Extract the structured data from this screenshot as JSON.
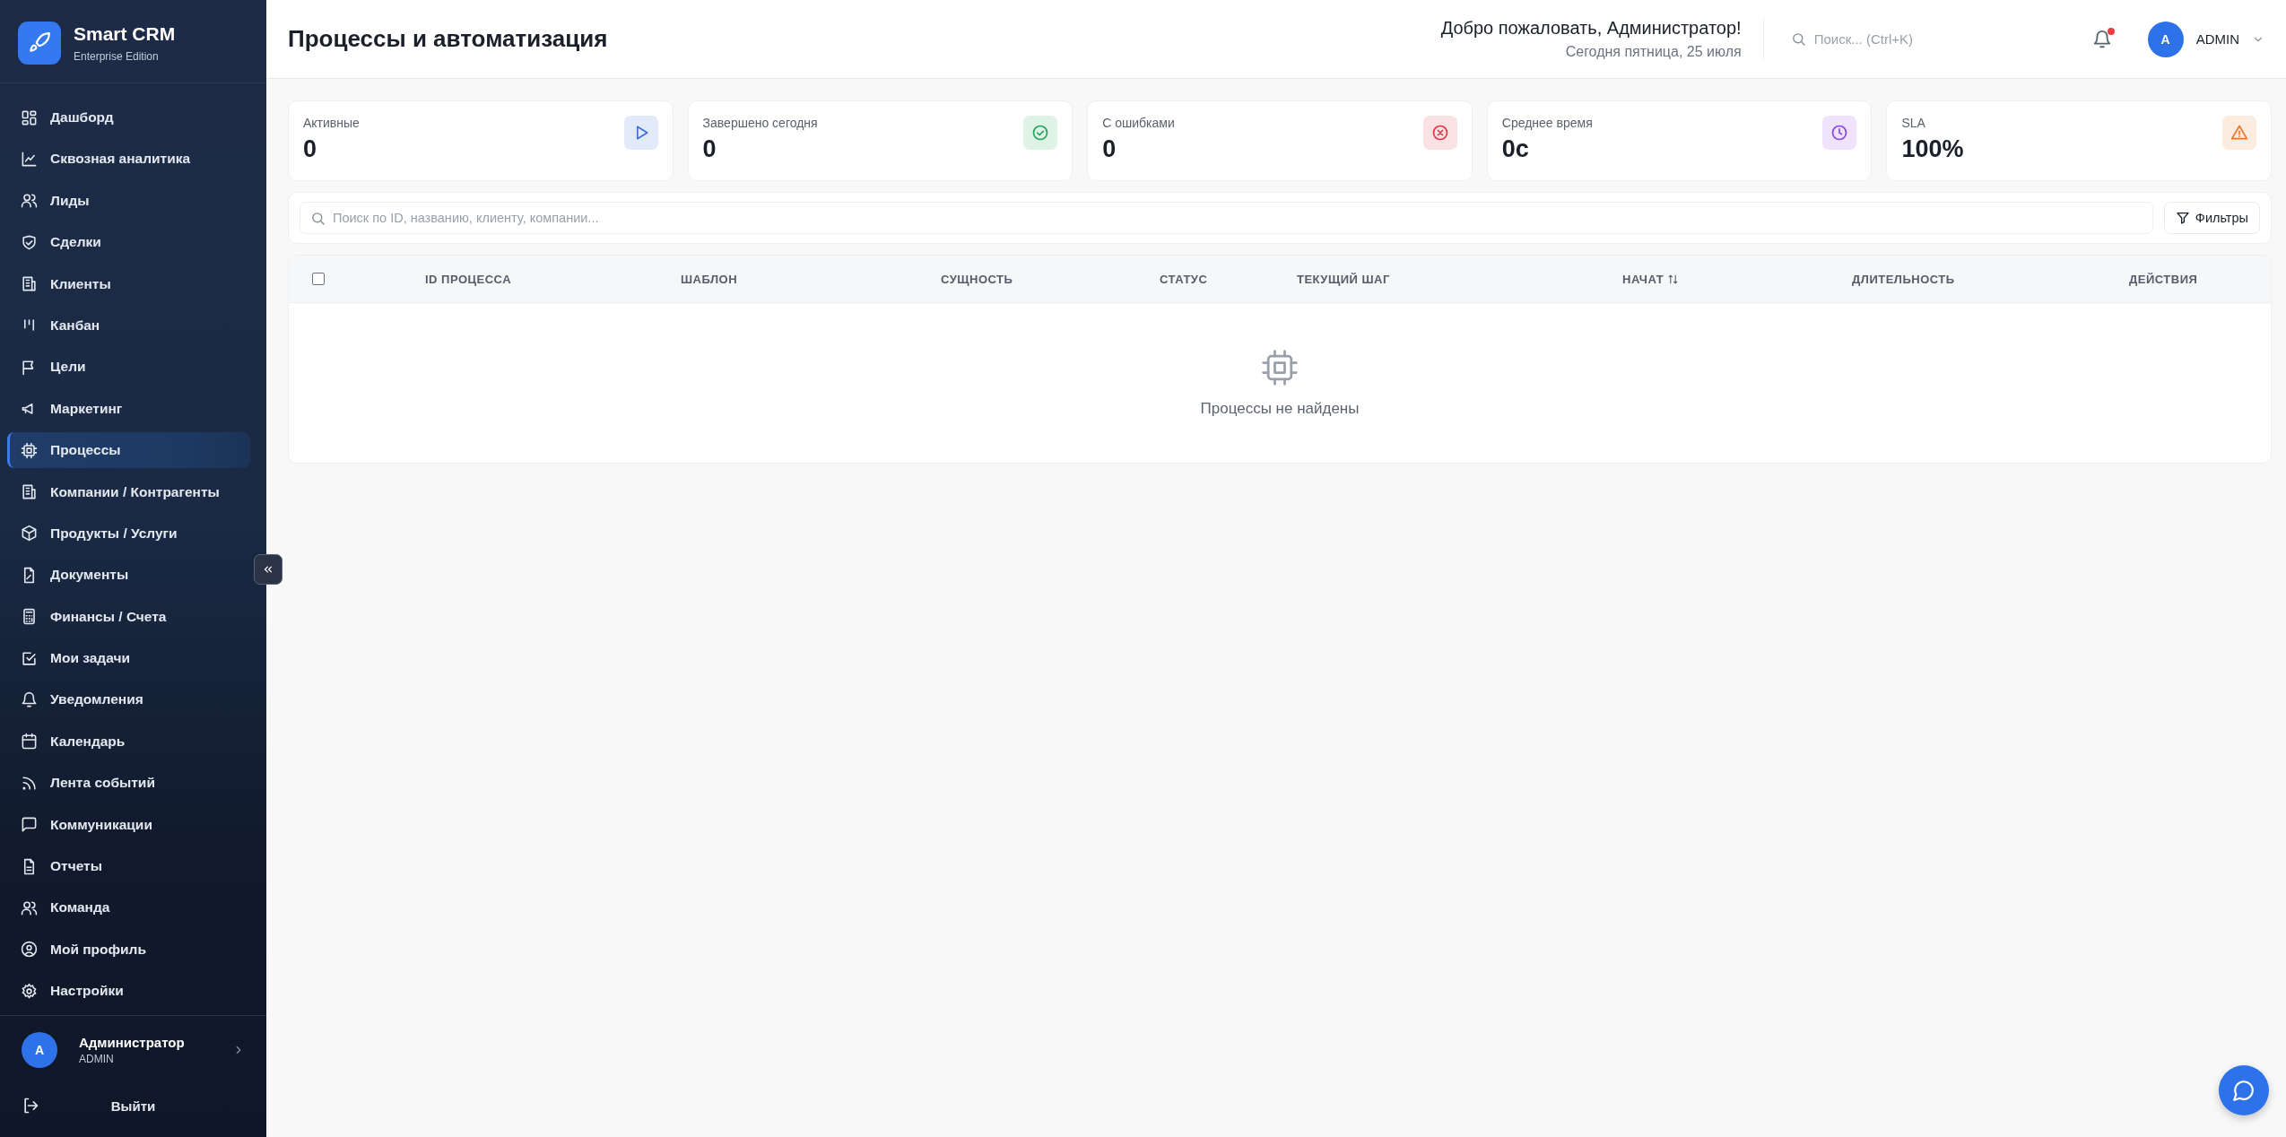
{
  "sidebar": {
    "brand": {
      "name": "Smart CRM",
      "edition": "Enterprise Edition"
    },
    "items": [
      {
        "label": "Дашборд",
        "selected": false
      },
      {
        "label": "Сквозная аналитика",
        "selected": false
      },
      {
        "label": "Лиды",
        "selected": false
      },
      {
        "label": "Сделки",
        "selected": false
      },
      {
        "label": "Клиенты",
        "selected": false
      },
      {
        "label": "Канбан",
        "selected": false
      },
      {
        "label": "Цели",
        "selected": false
      },
      {
        "label": "Маркетинг",
        "selected": false
      },
      {
        "label": "Процессы",
        "selected": true
      },
      {
        "label": "Компании / Контрагенты",
        "selected": false
      },
      {
        "label": "Продукты / Услуги",
        "selected": false
      },
      {
        "label": "Документы",
        "selected": false
      },
      {
        "label": "Финансы / Счета",
        "selected": false
      },
      {
        "label": "Мои задачи",
        "selected": false
      },
      {
        "label": "Уведомления",
        "selected": false
      },
      {
        "label": "Календарь",
        "selected": false
      },
      {
        "label": "Лента событий",
        "selected": false
      },
      {
        "label": "Коммуникации",
        "selected": false
      },
      {
        "label": "Отчеты",
        "selected": false
      },
      {
        "label": "Команда",
        "selected": false
      },
      {
        "label": "Мой профиль",
        "selected": false
      },
      {
        "label": "Настройки",
        "selected": false
      }
    ],
    "user": {
      "initial": "A",
      "name": "Администратор",
      "role": "ADMIN"
    },
    "logout": "Выйти"
  },
  "header": {
    "title": "Процессы и автоматизация",
    "welcome": "Добро пожаловать, Администратор!",
    "date": "Сегодня пятница, 25 июля",
    "search": {
      "placeholder": "Поиск... (Ctrl+K)"
    },
    "notifications": {
      "unread": true
    },
    "user": {
      "initial": "A",
      "name": "ADMIN"
    }
  },
  "stats": [
    {
      "label": "Активные",
      "value": "0",
      "kind": "play",
      "color": "#3b6fd8"
    },
    {
      "label": "Завершено сегодня",
      "value": "0",
      "kind": "check",
      "color": "#22a55a"
    },
    {
      "label": "С ошибками",
      "value": "0",
      "kind": "error",
      "color": "#dc3545"
    },
    {
      "label": "Среднее время",
      "value": "0с",
      "kind": "clock",
      "color": "#8b44e0"
    },
    {
      "label": "SLA",
      "value": "100%",
      "kind": "warning",
      "color": "#e8762a"
    }
  ],
  "filter": {
    "search": {
      "placeholder": "Поиск по ID, названию, клиенту, компании..."
    },
    "button": "Фильтры"
  },
  "table": {
    "columns": [
      {
        "kind": "checkbox",
        "checked": false
      },
      {
        "label": "ID ПРОЦЕССА",
        "sortable": false
      },
      {
        "label": "ШАБЛОН",
        "sortable": false
      },
      {
        "label": "СУЩНОСТЬ",
        "sortable": false
      },
      {
        "label": "СТАТУС",
        "sortable": false
      },
      {
        "label": "ТЕКУЩИЙ ШАГ",
        "sortable": false
      },
      {
        "label": "НАЧАТ",
        "sortable": true
      },
      {
        "label": "ДЛИТЕЛЬНОСТЬ",
        "sortable": false
      },
      {
        "label": "ДЕЙСТВИЯ",
        "sortable": false
      }
    ],
    "empty_message": "Процессы не найдены"
  }
}
